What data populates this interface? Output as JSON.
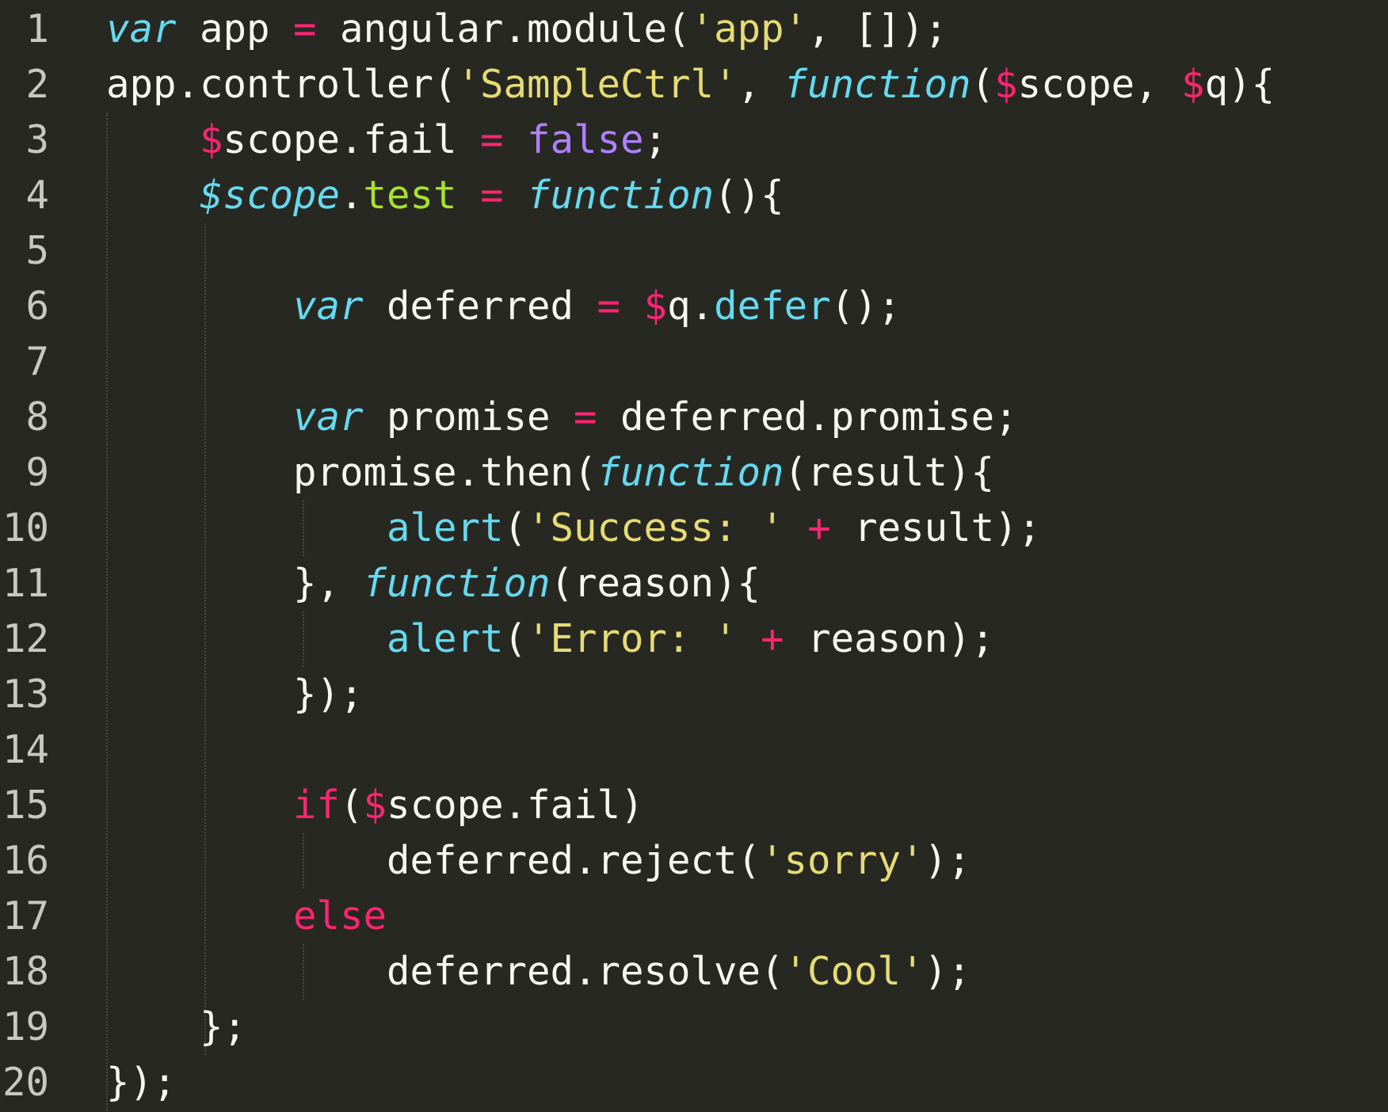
{
  "colors": {
    "background": "#272822",
    "line_number": "#C8C8C2",
    "plain": "#F8F8F2",
    "keyword_pink": "#F92672",
    "keyword_blue_italic": "#66D9EF",
    "string_yellow": "#E6DB74",
    "constant_purple": "#AE81FF",
    "property_green": "#A6E22E"
  },
  "editor": {
    "lines": [
      {
        "number": "1",
        "tokens": [
          {
            "t": "var",
            "c": "kw-it"
          },
          {
            "t": " app ",
            "c": "plain"
          },
          {
            "t": "=",
            "c": "op"
          },
          {
            "t": " angular.module(",
            "c": "plain"
          },
          {
            "t": "'app'",
            "c": "str"
          },
          {
            "t": ", []);",
            "c": "plain"
          }
        ]
      },
      {
        "number": "2",
        "tokens": [
          {
            "t": "app.controller(",
            "c": "plain"
          },
          {
            "t": "'SampleCtrl'",
            "c": "str"
          },
          {
            "t": ", ",
            "c": "plain"
          },
          {
            "t": "function",
            "c": "kw-it"
          },
          {
            "t": "(",
            "c": "plain"
          },
          {
            "t": "$",
            "c": "var"
          },
          {
            "t": "scope, ",
            "c": "plain"
          },
          {
            "t": "$",
            "c": "var"
          },
          {
            "t": "q){",
            "c": "plain"
          }
        ]
      },
      {
        "number": "3",
        "tokens": [
          {
            "t": "    ",
            "c": "plain"
          },
          {
            "t": "$",
            "c": "var"
          },
          {
            "t": "scope.fail ",
            "c": "plain"
          },
          {
            "t": "=",
            "c": "op"
          },
          {
            "t": " ",
            "c": "plain"
          },
          {
            "t": "false",
            "c": "const"
          },
          {
            "t": ";",
            "c": "plain"
          }
        ]
      },
      {
        "number": "4",
        "tokens": [
          {
            "t": "    ",
            "c": "plain"
          },
          {
            "t": "$scope",
            "c": "kw-it"
          },
          {
            "t": ".",
            "c": "plain"
          },
          {
            "t": "test",
            "c": "prop"
          },
          {
            "t": " ",
            "c": "plain"
          },
          {
            "t": "=",
            "c": "op"
          },
          {
            "t": " ",
            "c": "plain"
          },
          {
            "t": "function",
            "c": "kw-it"
          },
          {
            "t": "(){",
            "c": "plain"
          }
        ]
      },
      {
        "number": "5",
        "tokens": []
      },
      {
        "number": "6",
        "tokens": [
          {
            "t": "        ",
            "c": "plain"
          },
          {
            "t": "var",
            "c": "kw-it"
          },
          {
            "t": " deferred ",
            "c": "plain"
          },
          {
            "t": "=",
            "c": "op"
          },
          {
            "t": " ",
            "c": "plain"
          },
          {
            "t": "$",
            "c": "var"
          },
          {
            "t": "q.",
            "c": "plain"
          },
          {
            "t": "defer",
            "c": "fn"
          },
          {
            "t": "();",
            "c": "plain"
          }
        ]
      },
      {
        "number": "7",
        "tokens": []
      },
      {
        "number": "8",
        "tokens": [
          {
            "t": "        ",
            "c": "plain"
          },
          {
            "t": "var",
            "c": "kw-it"
          },
          {
            "t": " promise ",
            "c": "plain"
          },
          {
            "t": "=",
            "c": "op"
          },
          {
            "t": " deferred.promise;",
            "c": "plain"
          }
        ]
      },
      {
        "number": "9",
        "tokens": [
          {
            "t": "        promise.then(",
            "c": "plain"
          },
          {
            "t": "function",
            "c": "kw-it"
          },
          {
            "t": "(result){",
            "c": "plain"
          }
        ]
      },
      {
        "number": "10",
        "tokens": [
          {
            "t": "            ",
            "c": "plain"
          },
          {
            "t": "alert",
            "c": "fn"
          },
          {
            "t": "(",
            "c": "plain"
          },
          {
            "t": "'Success: '",
            "c": "str"
          },
          {
            "t": " ",
            "c": "plain"
          },
          {
            "t": "+",
            "c": "op"
          },
          {
            "t": " result);",
            "c": "plain"
          }
        ]
      },
      {
        "number": "11",
        "tokens": [
          {
            "t": "        }, ",
            "c": "plain"
          },
          {
            "t": "function",
            "c": "kw-it"
          },
          {
            "t": "(reason){",
            "c": "plain"
          }
        ]
      },
      {
        "number": "12",
        "tokens": [
          {
            "t": "            ",
            "c": "plain"
          },
          {
            "t": "alert",
            "c": "fn"
          },
          {
            "t": "(",
            "c": "plain"
          },
          {
            "t": "'Error: '",
            "c": "str"
          },
          {
            "t": " ",
            "c": "plain"
          },
          {
            "t": "+",
            "c": "op"
          },
          {
            "t": " reason);",
            "c": "plain"
          }
        ]
      },
      {
        "number": "13",
        "tokens": [
          {
            "t": "        });",
            "c": "plain"
          }
        ]
      },
      {
        "number": "14",
        "tokens": []
      },
      {
        "number": "15",
        "tokens": [
          {
            "t": "        ",
            "c": "plain"
          },
          {
            "t": "if",
            "c": "kw"
          },
          {
            "t": "(",
            "c": "plain"
          },
          {
            "t": "$",
            "c": "var"
          },
          {
            "t": "scope.fail)",
            "c": "plain"
          }
        ]
      },
      {
        "number": "16",
        "tokens": [
          {
            "t": "            deferred.reject(",
            "c": "plain"
          },
          {
            "t": "'sorry'",
            "c": "str"
          },
          {
            "t": ");",
            "c": "plain"
          }
        ]
      },
      {
        "number": "17",
        "tokens": [
          {
            "t": "        ",
            "c": "plain"
          },
          {
            "t": "else",
            "c": "kw"
          }
        ]
      },
      {
        "number": "18",
        "tokens": [
          {
            "t": "            deferred.resolve(",
            "c": "plain"
          },
          {
            "t": "'Cool'",
            "c": "str"
          },
          {
            "t": ");",
            "c": "plain"
          }
        ]
      },
      {
        "number": "19",
        "tokens": [
          {
            "t": "    };",
            "c": "plain"
          }
        ]
      },
      {
        "number": "20",
        "tokens": [
          {
            "t": "});",
            "c": "plain"
          }
        ]
      }
    ]
  }
}
